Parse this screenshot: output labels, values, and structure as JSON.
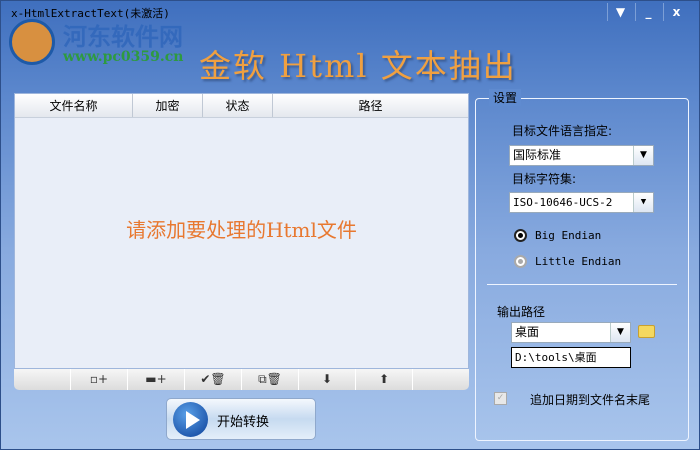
{
  "window": {
    "title": "x-HtmlExtractText(未激活)",
    "menu": "▼",
    "minimize": "_",
    "close": "x"
  },
  "watermark": {
    "site": "河东软件网",
    "url": "www.pc0359.cn"
  },
  "brand": "金软 Html 文本抽出",
  "list": {
    "columns": [
      "文件名称",
      "加密",
      "状态",
      "路径"
    ],
    "empty_hint": "请添加要处理的Html文件"
  },
  "toolbar": {
    "add_file": "▫+",
    "add_folder": "▬+",
    "remove_checked": "✔🗑",
    "remove_all": "⧉🗑",
    "move_down": "⬇",
    "move_up": "⬆"
  },
  "start_button": "开始转换",
  "settings": {
    "group_label": "设置",
    "lang_label": "目标文件语言指定:",
    "lang_value": "国际标准",
    "charset_label": "目标字符集:",
    "charset_value": "ISO-10646-UCS-2",
    "big_endian": "Big Endian",
    "little_endian": "Little Endian",
    "output_label": "输出路径",
    "output_value": "桌面",
    "output_path": "D:\\tools\\桌面",
    "append_date": "追加日期到文件名末尾"
  }
}
